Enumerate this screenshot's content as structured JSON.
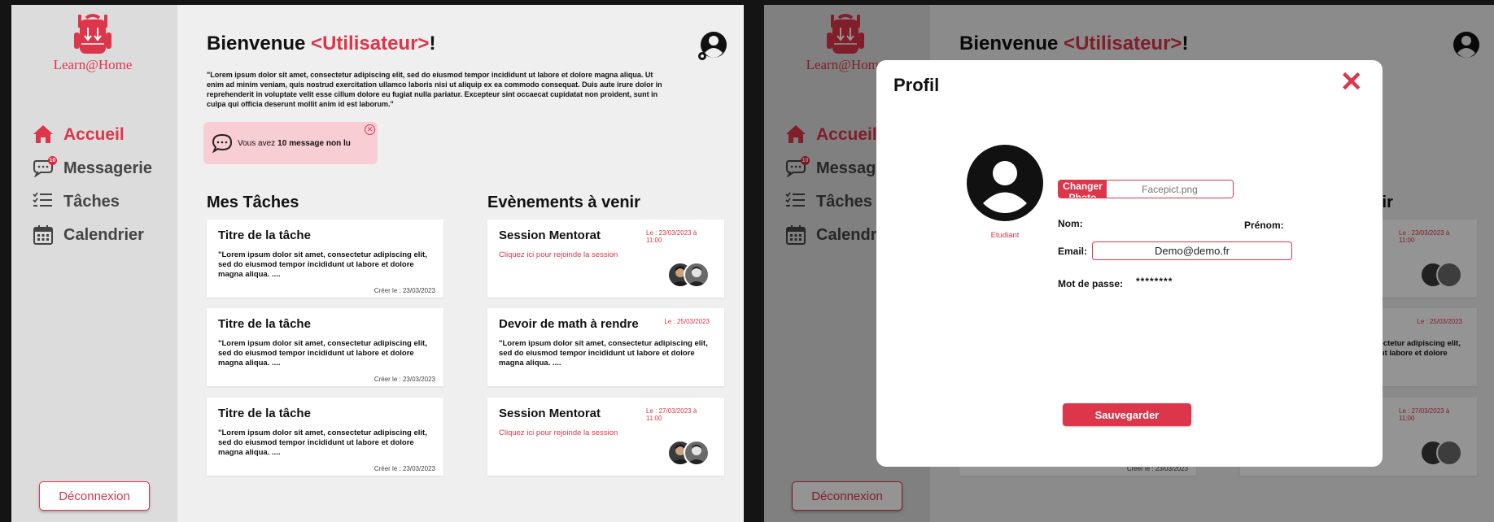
{
  "app": {
    "logo_text": "Learn@Home",
    "accent": "#dd3549",
    "badge_count": "10"
  },
  "sidebar": {
    "items": [
      {
        "label": "Accueil",
        "icon": "home-icon"
      },
      {
        "label": "Messagerie",
        "icon": "chat-icon"
      },
      {
        "label": "Tâches",
        "icon": "checklist-icon"
      },
      {
        "label": "Calendrier",
        "icon": "calendar-icon"
      }
    ],
    "logout_label": "Déconnexion"
  },
  "header": {
    "welcome_prefix": "Bienvenue ",
    "welcome_user": "<Utilisateur>",
    "welcome_suffix": "!",
    "intro": "\"Lorem ipsum dolor sit amet, consectetur adipiscing elit, sed do eiusmod tempor incididunt ut labore et dolore magna aliqua. Ut enim ad minim veniam, quis nostrud exercitation ullamco laboris nisi ut aliquip ex ea commodo consequat. Duis aute irure dolor in reprehenderit in voluptate velit esse cillum dolore eu fugiat nulla pariatur. Excepteur sint occaecat cupidatat non proident, sunt in culpa qui officia deserunt mollit anim id est laborum.\""
  },
  "notification": {
    "prefix": "Vous avez",
    "count": "10",
    "suffix": "message non lu"
  },
  "tasks": {
    "title": "Mes Tâches",
    "items": [
      {
        "title": "Titre de la tâche",
        "text": "\"Lorem ipsum dolor sit amet, consectetur adipiscing elit, sed do eiusmod tempor incididunt ut labore et dolore magna aliqua. ....",
        "date": "Créer le : 23/03/2023"
      },
      {
        "title": "Titre de la tâche",
        "text": "\"Lorem ipsum dolor sit amet, consectetur adipiscing elit, sed do eiusmod tempor incididunt ut labore et dolore magna aliqua. ....",
        "date": "Créer le : 23/03/2023"
      },
      {
        "title": "Titre de la tâche",
        "text": "\"Lorem ipsum dolor sit amet, consectetur adipiscing elit, sed do eiusmod tempor incididunt ut labore et dolore magna aliqua. ....",
        "date": "Créer le : 23/03/2023"
      }
    ]
  },
  "events": {
    "title": "Evènements à venir",
    "items": [
      {
        "title": "Session Mentorat",
        "date": "Le : 23/03/2023 à 11:00",
        "link": "Cliquez ici pour rejoinde la session"
      },
      {
        "title": "Devoir de math à rendre",
        "date": "Le : 25/03/2023",
        "text": "\"Lorem ipsum dolor sit amet, consectetur adipiscing elit, sed do eiusmod tempor incididunt ut labore et dolore magna aliqua. ...."
      },
      {
        "title": "Session Mentorat",
        "date": "Le : 27/03/2023 à 11:00",
        "link": "Cliquez ici pour rejoinde la session"
      }
    ]
  },
  "modal": {
    "title": "Profil",
    "role": "Etudiant",
    "change_photo": "Changer Photo",
    "photo_file": "Facepict.png",
    "nom_label": "Nom:",
    "prenom_label": "Prénom:",
    "email_label": "Email:",
    "email_value": "Demo@demo.fr",
    "password_label": "Mot de passe:",
    "password_value": "********",
    "save_label": "Sauvegarder"
  }
}
